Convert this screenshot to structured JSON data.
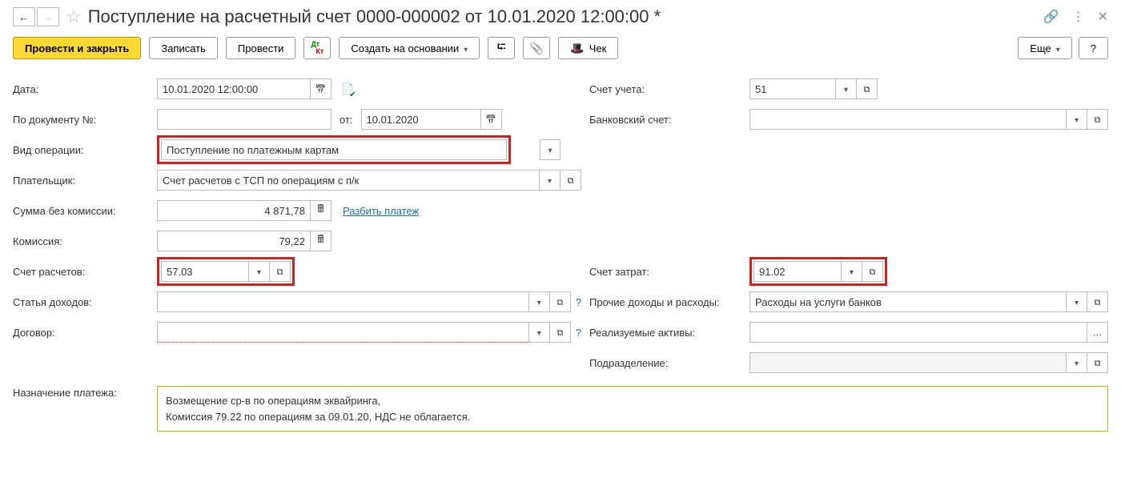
{
  "page_title": "Поступление на расчетный счет 0000-000002 от 10.01.2020 12:00:00 *",
  "toolbar": {
    "conduct_close": "Провести и закрыть",
    "save": "Записать",
    "conduct": "Провести",
    "create_based": "Создать на основании",
    "check": "Чек",
    "more": "Еще",
    "help": "?"
  },
  "left": {
    "date_label": "Дата:",
    "date_value": "10.01.2020 12:00:00",
    "docnum_label": "По документу №:",
    "docnum_value": "",
    "from_label": "от:",
    "from_value": "10.01.2020",
    "op_label": "Вид операции:",
    "op_value": "Поступление по платежным картам",
    "payer_label": "Плательщик:",
    "payer_value": "Счет расчетов с ТСП по операциям с п/к",
    "sumnocomm_label": "Сумма без комиссии:",
    "sumnocomm_value": "4 871,78",
    "split_link": "Разбить платеж",
    "comm_label": "Комиссия:",
    "comm_value": "79,22",
    "calcacc_label": "Счет расчетов:",
    "calcacc_value": "57.03",
    "income_label": "Статья доходов:",
    "income_value": "",
    "contract_label": "Договор:",
    "contract_value": ""
  },
  "right": {
    "acc_label": "Счет учета:",
    "acc_value": "51",
    "bank_label": "Банковский счет:",
    "bank_value": "",
    "cost_label": "Счет затрат:",
    "cost_value": "91.02",
    "other_label": "Прочие доходы и расходы:",
    "other_value": "Расходы на услуги банков",
    "assets_label": "Реализуемые активы:",
    "assets_value": "",
    "div_label": "Подразделение:",
    "div_value": ""
  },
  "purpose": {
    "label": "Назначение платежа:",
    "line1": "Возмещение ср-в по операциям эквайринга,",
    "line2": "Комиссия 79.22 по операциям за 09.01.20, НДС не облагается."
  }
}
